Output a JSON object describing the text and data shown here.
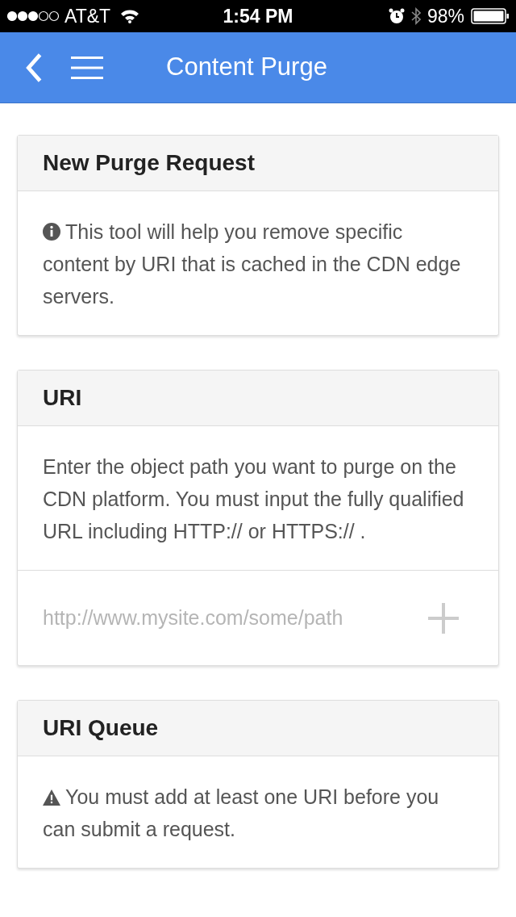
{
  "status_bar": {
    "carrier": "AT&T",
    "time": "1:54 PM",
    "battery": "98%"
  },
  "nav_bar": {
    "title": "Content Purge"
  },
  "cards": [
    {
      "title": "New Purge Request",
      "sections": [
        {
          "kind": "info",
          "text": "This tool will help you remove specific content by URI that is cached in the CDN edge servers."
        }
      ]
    },
    {
      "title": "URI",
      "sections": [
        {
          "kind": "text",
          "text": "Enter the object path you want to purge on the CDN platform. You must input the fully qualified URL including HTTP:// or HTTPS:// ."
        },
        {
          "kind": "input",
          "placeholder": "http://www.mysite.com/some/path"
        }
      ]
    },
    {
      "title": "URI Queue",
      "sections": [
        {
          "kind": "warning",
          "text": "You must add at least one URI before you can submit a request."
        }
      ]
    }
  ]
}
